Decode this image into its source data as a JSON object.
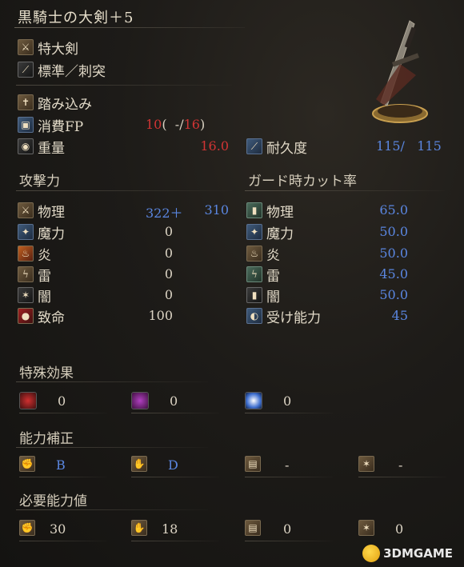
{
  "weapon": {
    "name": "黒騎士の大剣＋5",
    "category": "特大剣",
    "attack_type": "標準／刺突",
    "skill": "踏み込み",
    "fp": {
      "label": "消費FP",
      "cost": "10",
      "open": "(",
      "mid": "-/",
      "max": "16",
      "close": ")"
    },
    "weight": {
      "label": "重量",
      "value": "16.0"
    },
    "durability": {
      "label": "耐久度",
      "current": "115/",
      "max": "115"
    }
  },
  "attack": {
    "title": "攻撃力",
    "rows": [
      {
        "label": "物理",
        "base": "322＋",
        "bonus": "310"
      },
      {
        "label": "魔力",
        "base": "",
        "bonus": "0"
      },
      {
        "label": "炎",
        "base": "",
        "bonus": "0"
      },
      {
        "label": "雷",
        "base": "",
        "bonus": "0"
      },
      {
        "label": "闇",
        "base": "",
        "bonus": "0"
      },
      {
        "label": "致命",
        "base": "",
        "bonus": "100"
      }
    ]
  },
  "guard": {
    "title": "ガード時カット率",
    "rows": [
      {
        "label": "物理",
        "value": "65.0"
      },
      {
        "label": "魔力",
        "value": "50.0"
      },
      {
        "label": "炎",
        "value": "50.0"
      },
      {
        "label": "雷",
        "value": "45.0"
      },
      {
        "label": "闇",
        "value": "50.0"
      },
      {
        "label": "受け能力",
        "value": "45"
      }
    ]
  },
  "effects": {
    "title": "特殊効果",
    "values": [
      "0",
      "0",
      "0"
    ]
  },
  "scaling": {
    "title": "能力補正",
    "values": [
      "B",
      "D",
      "-",
      "-"
    ]
  },
  "requirements": {
    "title": "必要能力値",
    "values": [
      "30",
      "18",
      "0",
      "0"
    ]
  },
  "watermark": "3DMGAME",
  "colors": {
    "red": "#d03434",
    "blue": "#5a86e0",
    "text": "#dcd4c4"
  }
}
